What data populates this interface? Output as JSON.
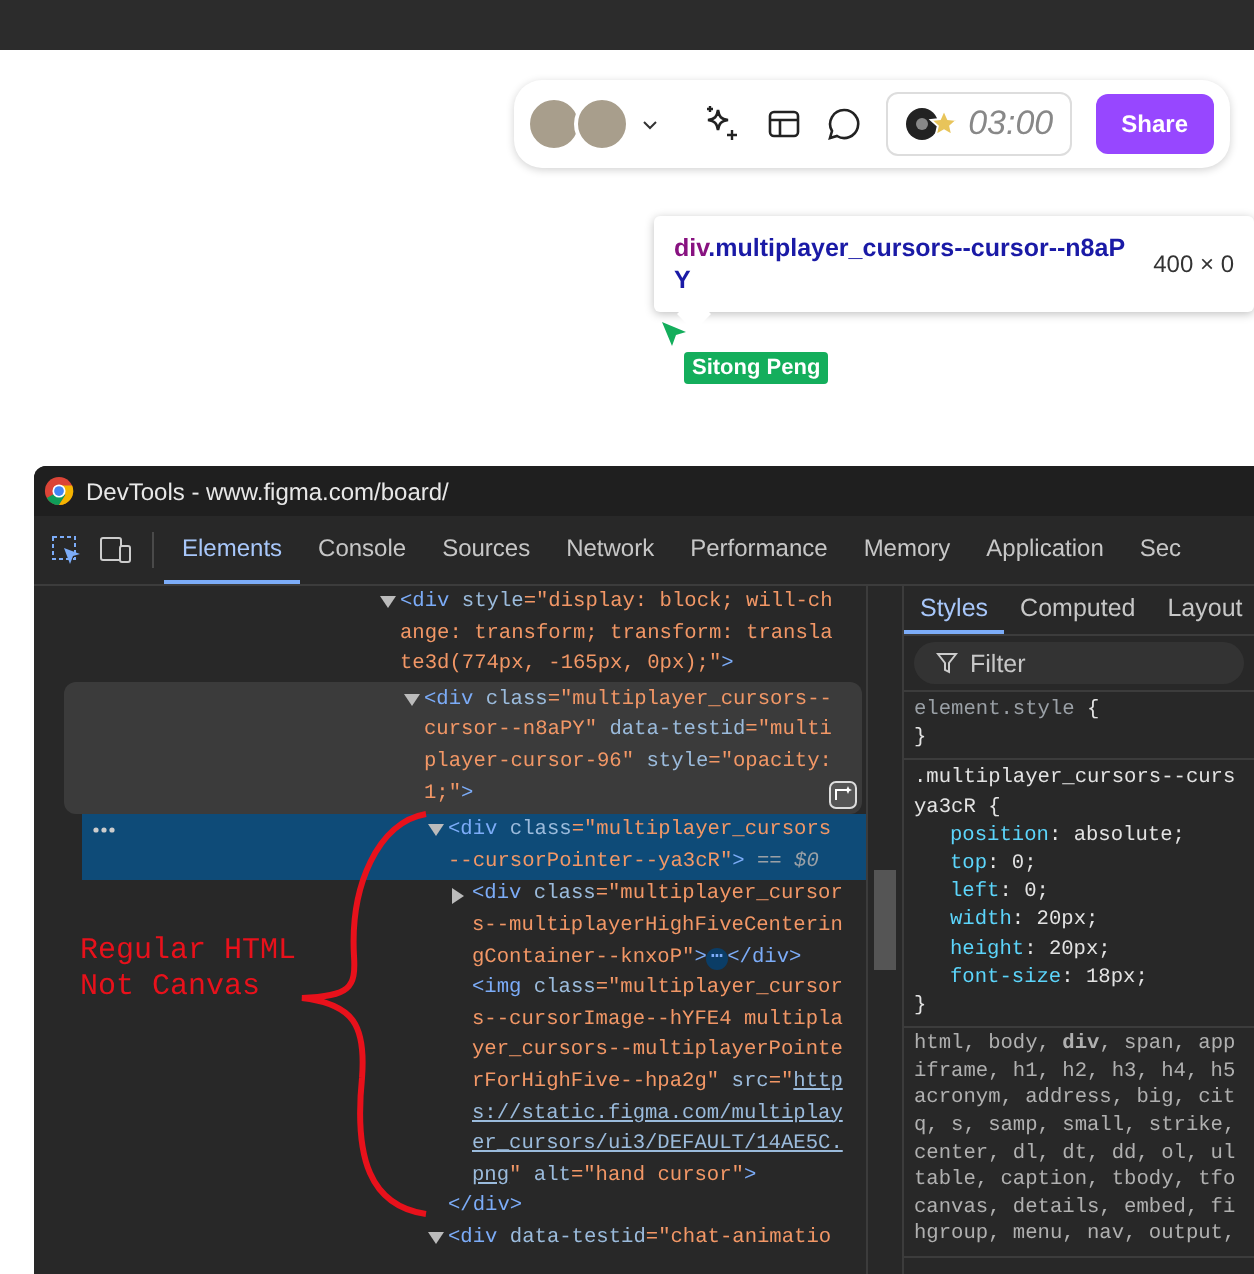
{
  "toolbar": {
    "avatars": [
      {
        "kind": "photo"
      },
      {
        "kind": "photo"
      }
    ],
    "timer": "03:00",
    "share_button": "Share"
  },
  "inspect_tooltip": {
    "tag": "div",
    "class_name": ".multiplayer_cursors--cursor--n8aPY",
    "size": "400 × 0"
  },
  "cursor": {
    "name": "Sitong Peng",
    "color": "#14ae5c"
  },
  "devtools": {
    "title": "DevTools - www.figma.com/board/",
    "tabs": [
      {
        "label": "Elements",
        "selected": true
      },
      {
        "label": "Console",
        "selected": false
      },
      {
        "label": "Sources",
        "selected": false
      },
      {
        "label": "Network",
        "selected": false
      },
      {
        "label": "Performance",
        "selected": false
      },
      {
        "label": "Memory",
        "selected": false
      },
      {
        "label": "Application",
        "selected": false
      },
      {
        "label": "Sec",
        "selected": false
      }
    ],
    "dom_tree": [
      {
        "kind": "container",
        "expanded": true,
        "selected": false,
        "hovered": false,
        "open_lines": [
          [
            {
              "kind": "tag",
              "text": "<div "
            },
            {
              "kind": "attr",
              "text": "style"
            },
            {
              "kind": "value",
              "text": "=\"display: block; will-ch"
            }
          ],
          [
            {
              "kind": "value",
              "text": "ange: transform; transform: transla"
            }
          ],
          [
            {
              "kind": "value",
              "text": "te3d(774px, -165px, 0px);\""
            },
            {
              "kind": "tag",
              "text": ">"
            }
          ]
        ],
        "children": [
          {
            "kind": "container",
            "expanded": true,
            "selected": false,
            "hovered": true,
            "open_lines": [
              [
                {
                  "kind": "tag",
                  "text": "<div "
                },
                {
                  "kind": "attr",
                  "text": "class"
                },
                {
                  "kind": "value",
                  "text": "=\"multiplayer_cursors--"
                }
              ],
              [
                {
                  "kind": "value",
                  "text": "cursor--n8aPY\" "
                },
                {
                  "kind": "attr",
                  "text": "data-testid"
                },
                {
                  "kind": "value",
                  "text": "=\"multi"
                }
              ],
              [
                {
                  "kind": "value",
                  "text": "player-cursor-96\" "
                },
                {
                  "kind": "attr",
                  "text": "style"
                },
                {
                  "kind": "value",
                  "text": "=\"opacity:"
                }
              ],
              [
                {
                  "kind": "value",
                  "text": "1;\""
                },
                {
                  "kind": "tag",
                  "text": ">"
                }
              ]
            ],
            "children": [
              {
                "kind": "container",
                "expanded": true,
                "selected": true,
                "hovered": false,
                "open_lines": [
                  [
                    {
                      "kind": "tag",
                      "text": "<div "
                    },
                    {
                      "kind": "attr",
                      "text": "class"
                    },
                    {
                      "kind": "value",
                      "text": "=\"multiplayer_cursors"
                    }
                  ],
                  [
                    {
                      "kind": "value",
                      "text": "--cursorPointer--ya3cR\""
                    },
                    {
                      "kind": "tag",
                      "text": ">"
                    },
                    {
                      "kind": "marker",
                      "text": " == $0"
                    }
                  ]
                ],
                "children": [
                  {
                    "kind": "container",
                    "expanded": false,
                    "selected": false,
                    "hovered": false,
                    "open_lines": [
                      [
                        {
                          "kind": "tag",
                          "text": "<div "
                        },
                        {
                          "kind": "attr",
                          "text": "class"
                        },
                        {
                          "kind": "value",
                          "text": "=\"multiplayer_cursor"
                        }
                      ],
                      [
                        {
                          "kind": "value",
                          "text": "s--multiplayerHighFiveCenterin"
                        }
                      ],
                      [
                        {
                          "kind": "value",
                          "text": "gContainer--knxoP\""
                        },
                        {
                          "kind": "tag",
                          "text": ">"
                        },
                        {
                          "kind": "ellipsis",
                          "text": "⋯"
                        },
                        {
                          "kind": "tag",
                          "text": "</div>"
                        }
                      ]
                    ]
                  },
                  {
                    "kind": "leaf",
                    "selected": false,
                    "hovered": false,
                    "open_lines": [
                      [
                        {
                          "kind": "tag",
                          "text": "<img "
                        },
                        {
                          "kind": "attr",
                          "text": "class"
                        },
                        {
                          "kind": "value",
                          "text": "=\"multiplayer_cursor"
                        }
                      ],
                      [
                        {
                          "kind": "value",
                          "text": "s--cursorImage--hYFE4 multipla"
                        }
                      ],
                      [
                        {
                          "kind": "value",
                          "text": "yer_cursors--multiplayerPointe"
                        }
                      ],
                      [
                        {
                          "kind": "value",
                          "text": "rForHighFive--hpa2g\" "
                        },
                        {
                          "kind": "attr",
                          "text": "src"
                        },
                        {
                          "kind": "value",
                          "text": "=\""
                        },
                        {
                          "kind": "link",
                          "text": "http"
                        }
                      ],
                      [
                        {
                          "kind": "link",
                          "text": "s://static.figma.com/multiplay"
                        }
                      ],
                      [
                        {
                          "kind": "link",
                          "text": "er_cursors/ui3/DEFAULT/14AE5C."
                        }
                      ],
                      [
                        {
                          "kind": "link",
                          "text": "png"
                        },
                        {
                          "kind": "value",
                          "text": "\" "
                        },
                        {
                          "kind": "attr",
                          "text": "alt"
                        },
                        {
                          "kind": "value",
                          "text": "=\"hand cursor\""
                        },
                        {
                          "kind": "tag",
                          "text": ">"
                        }
                      ]
                    ]
                  }
                ],
                "close_lines": [
                  [
                    {
                      "kind": "tag",
                      "text": "</div>"
                    }
                  ]
                ]
              },
              {
                "kind": "container",
                "expanded": true,
                "selected": false,
                "hovered": false,
                "open_lines": [
                  [
                    {
                      "kind": "tag",
                      "text": "<div "
                    },
                    {
                      "kind": "attr",
                      "text": "data-testid"
                    },
                    {
                      "kind": "value",
                      "text": "=\"chat-animatio"
                    }
                  ]
                ]
              }
            ]
          }
        ]
      }
    ],
    "annotation": {
      "lines": [
        "Regular HTML",
        "Not Canvas"
      ]
    },
    "styles_tabs": [
      {
        "label": "Styles",
        "selected": true
      },
      {
        "label": "Computed",
        "selected": false
      },
      {
        "label": "Layout",
        "selected": false
      }
    ],
    "filter": {
      "placeholder": "Filter"
    },
    "rules": [
      {
        "kind": "inline",
        "selector_lines": [
          "element.style"
        ],
        "open_brace": "{",
        "close_brace": "}"
      },
      {
        "kind": "author",
        "selector_lines": [
          ".multiplayer_cursors--curs",
          "ya3cR"
        ],
        "open_brace": "{",
        "close_brace": "}",
        "properties": [
          {
            "name": "position",
            "separator": ":",
            "value": "absolute;"
          },
          {
            "name": "top",
            "separator": ":",
            "value": "0;"
          },
          {
            "name": "left",
            "separator": ":",
            "value": "0;"
          },
          {
            "name": "width",
            "separator": ":",
            "value": "20px;"
          },
          {
            "name": "height",
            "separator": ":",
            "value": "20px;"
          },
          {
            "name": "font-size",
            "separator": ":",
            "value": "18px;"
          }
        ]
      },
      {
        "kind": "user-agent",
        "selector_lines": [
          "html, body, **div**, span, app",
          "iframe, h1, h2, h3, h4, h5",
          "acronym, address, big, cit",
          "q, s, samp, small, strike,",
          "center, dl, dt, dd, ol, ul",
          "table, caption, tbody, tfo",
          "canvas, details, embed, fi",
          "hgroup, menu, nav, output,"
        ]
      }
    ]
  }
}
